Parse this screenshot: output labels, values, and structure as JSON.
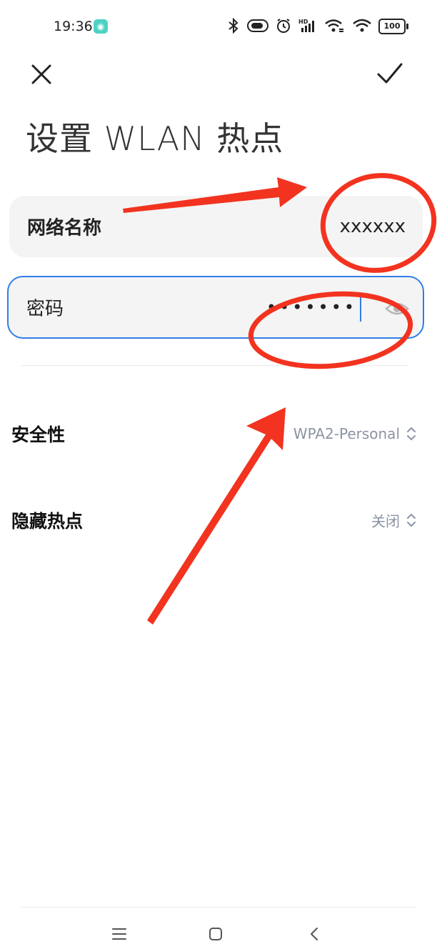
{
  "status_bar": {
    "time": "19:36",
    "app_badge": "◉",
    "icons": [
      "bluetooth-icon",
      "toggle-icon",
      "alarm-icon",
      "hd-signal-icon",
      "wifi-link-icon",
      "wifi-icon"
    ],
    "hd_label": "HD",
    "battery": "100"
  },
  "toolbar": {
    "close_icon": "close-icon",
    "confirm_icon": "check-icon"
  },
  "page": {
    "title": "设置 WLAN 热点"
  },
  "form": {
    "ssid": {
      "label": "网络名称",
      "value": "xxxxxx"
    },
    "password": {
      "label": "密码",
      "masked_value": "•••••••",
      "toggle_icon": "eye-icon"
    }
  },
  "settings": {
    "security": {
      "label": "安全性",
      "value": "WPA2-Personal"
    },
    "hidden_hotspot": {
      "label": "隐藏热点",
      "value": "关闭"
    }
  },
  "nav_bar": {
    "menu_icon": "menu-icon",
    "home_icon": "home-icon",
    "back_icon": "back-icon"
  },
  "colors": {
    "accent": "#2f7ee6",
    "annotation": "#f2331f",
    "secondary_text": "#8b93a3"
  }
}
